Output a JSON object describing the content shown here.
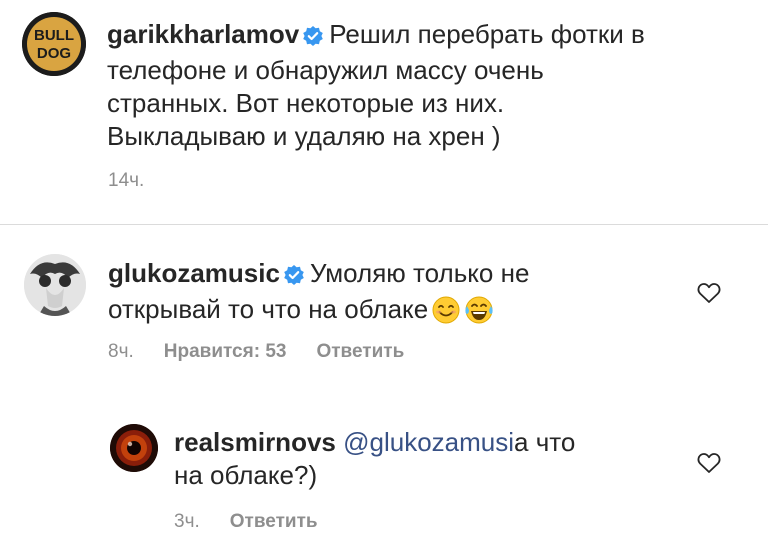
{
  "caption": {
    "username": "garikkharlamov",
    "avatar_text_top": "BULL",
    "avatar_text_bottom": "DOG",
    "line1": "Решил перебрать фотки в",
    "line2": "телефоне и обнаружил массу очень",
    "line3": "странных. Вот некоторые из них.",
    "line4": "Выкладываю и удаляю на хрен )",
    "time": "14ч."
  },
  "comment1": {
    "username": "glukozamusic",
    "line1": "Умоляю только не",
    "line2": "открывай то что на облаке",
    "time": "8ч.",
    "likes": "Нравится: 53",
    "reply_label": "Ответить"
  },
  "comment2": {
    "username": "realsmirnovs",
    "mention": "@glukozamusi",
    "line1_rest": "a что",
    "line2": "на облаке?)",
    "time": "3ч.",
    "reply_label": "Ответить"
  },
  "colors": {
    "verified": "#3897f0",
    "meta_text": "#8e8e8e",
    "mention": "#385185"
  }
}
